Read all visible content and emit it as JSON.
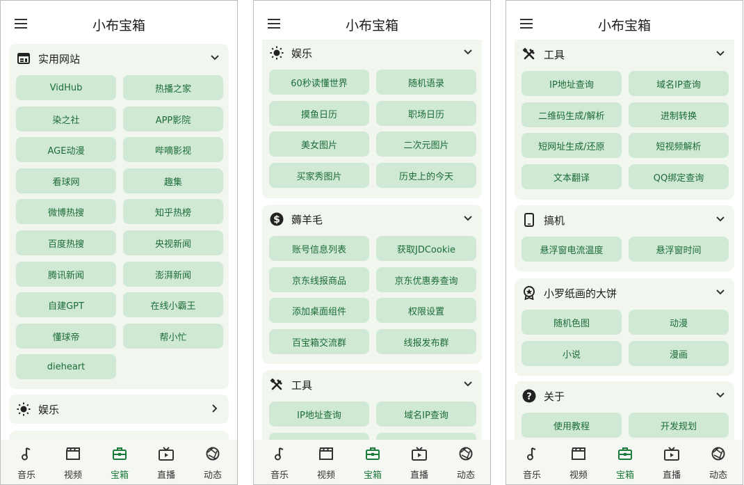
{
  "app": {
    "title": "小布宝箱"
  },
  "nav": [
    {
      "label": "音乐",
      "icon": "music-note-icon"
    },
    {
      "label": "视频",
      "icon": "clapperboard-icon"
    },
    {
      "label": "宝箱",
      "icon": "toolbox-icon"
    },
    {
      "label": "直播",
      "icon": "tv-icon"
    },
    {
      "label": "动态",
      "icon": "shutter-icon"
    }
  ],
  "screens": [
    {
      "cards": [
        {
          "title": "实用网站",
          "icon": "web-window-icon",
          "expanded": true,
          "items": [
            "VidHub",
            "热播之家",
            "染之社",
            "APP影院",
            "AGE动漫",
            "哔嘀影视",
            "看球网",
            "趣集",
            "微博热搜",
            "知乎热榜",
            "百度热搜",
            "央视新闻",
            "腾讯新闻",
            "澎湃新闻",
            "自建GPT",
            "在线小霸王",
            "懂球帝",
            "帮小忙",
            "dieheart"
          ]
        },
        {
          "title": "娱乐",
          "icon": "sun-icon",
          "expanded": false,
          "items": []
        }
      ]
    },
    {
      "cards": [
        {
          "title": "娱乐",
          "icon": "sun-icon",
          "expanded": true,
          "items": [
            "60秒读懂世界",
            "随机语录",
            "摸鱼日历",
            "职场日历",
            "美女图片",
            "二次元图片",
            "买家秀图片",
            "历史上的今天"
          ]
        },
        {
          "title": "薅羊毛",
          "icon": "dollar-icon",
          "expanded": true,
          "items": [
            "账号信息列表",
            "获取JDCookie",
            "京东线报商品",
            "京东优惠券查询",
            "添加桌面组件",
            "权限设置",
            "百宝箱交流群",
            "线报发布群"
          ]
        },
        {
          "title": "工具",
          "icon": "tools-icon",
          "expanded": true,
          "items": [
            "IP地址查询",
            "域名IP查询"
          ]
        }
      ]
    },
    {
      "cards": [
        {
          "title": "工具",
          "icon": "tools-icon",
          "expanded": true,
          "items": [
            "IP地址查询",
            "域名IP查询",
            "二维码生成/解析",
            "进制转换",
            "短网址生成/还原",
            "短视频解析",
            "文本翻译",
            "QQ绑定查询"
          ]
        },
        {
          "title": "搞机",
          "icon": "phone-icon",
          "expanded": true,
          "items": [
            "悬浮窗电流温度",
            "悬浮窗时间"
          ]
        },
        {
          "title": "小罗纸画的大饼",
          "icon": "badge-icon",
          "expanded": true,
          "items": [
            "随机色图",
            "动漫",
            "小说",
            "漫画"
          ]
        },
        {
          "title": "关于",
          "icon": "help-icon",
          "expanded": true,
          "items": [
            "使用教程",
            "开发规划"
          ]
        }
      ]
    }
  ]
}
